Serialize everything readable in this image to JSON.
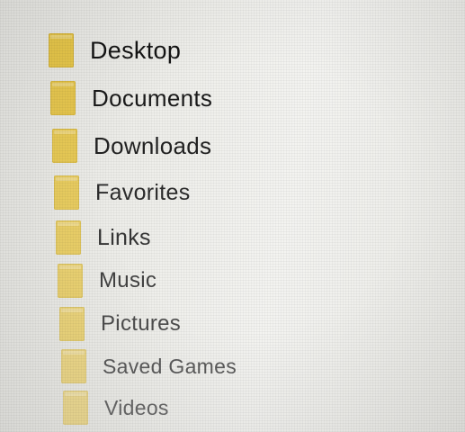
{
  "folders": [
    {
      "label": "Desktop",
      "icon": "folder-icon"
    },
    {
      "label": "Documents",
      "icon": "folder-icon"
    },
    {
      "label": "Downloads",
      "icon": "folder-icon"
    },
    {
      "label": "Favorites",
      "icon": "folder-icon"
    },
    {
      "label": "Links",
      "icon": "folder-icon"
    },
    {
      "label": "Music",
      "icon": "folder-icon"
    },
    {
      "label": "Pictures",
      "icon": "folder-icon"
    },
    {
      "label": "Saved Games",
      "icon": "folder-icon"
    },
    {
      "label": "Videos",
      "icon": "folder-icon"
    }
  ],
  "colors": {
    "background": "#eeeeea",
    "folder": "#e8ca56",
    "text": "#1a1a1a"
  }
}
